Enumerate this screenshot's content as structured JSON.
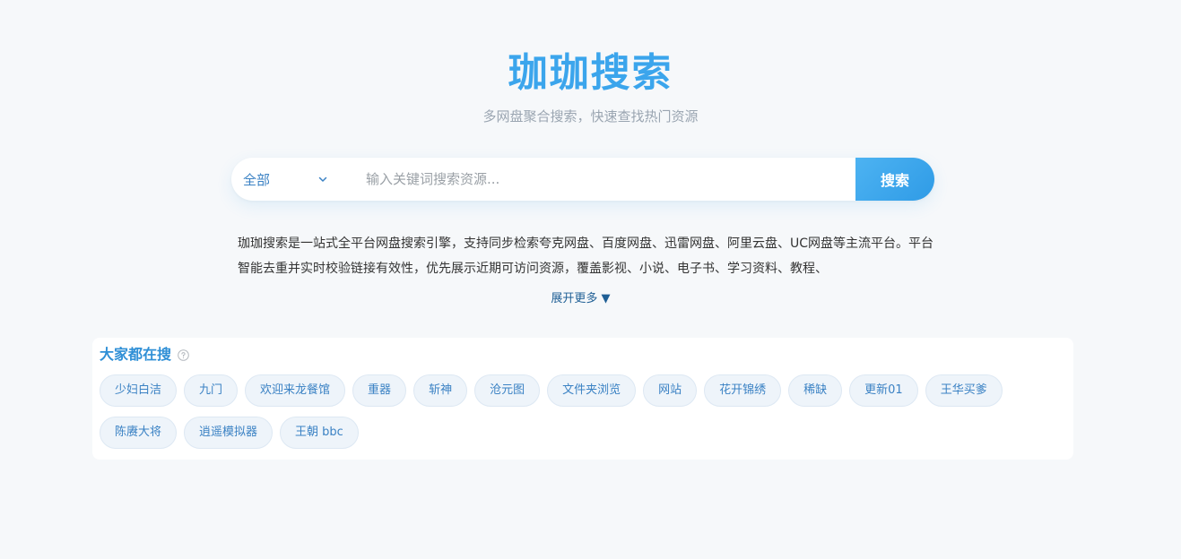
{
  "header": {
    "title": "珈珈搜索",
    "subtitle": "多网盘聚合搜索，快速查找热门资源"
  },
  "search": {
    "scope_label": "全部",
    "placeholder": "输入关键词搜索资源...",
    "button_label": "搜索"
  },
  "intro": {
    "text": "珈珈搜索是一站式全平台网盘搜索引擎，支持同步检索夸克网盘、百度网盘、迅雷网盘、阿里云盘、UC网盘等主流平台。平台智能去重并实时校验链接有效性，优先展示近期可访问资源，覆盖影视、小说、电子书、学习资料、教程、",
    "expand_label": "展开更多 ▼"
  },
  "hot": {
    "title": "大家都在搜",
    "tags": [
      "少妇白洁",
      "九门",
      "欢迎来龙餐馆",
      "重器",
      "斩神",
      "沧元图",
      "文件夹浏览",
      "网站",
      "花开锦绣",
      "稀缺",
      "更新01",
      "王华买爹",
      "陈赓大将",
      "逍遥模拟器",
      "王朝 bbc"
    ]
  },
  "colors": {
    "accent": "#3ba5ec",
    "link": "#3b82c4",
    "background": "#f6f8fa"
  },
  "icons": {
    "scope_chevron": "chevron-down-icon",
    "hot_help": "help-circle-icon"
  }
}
